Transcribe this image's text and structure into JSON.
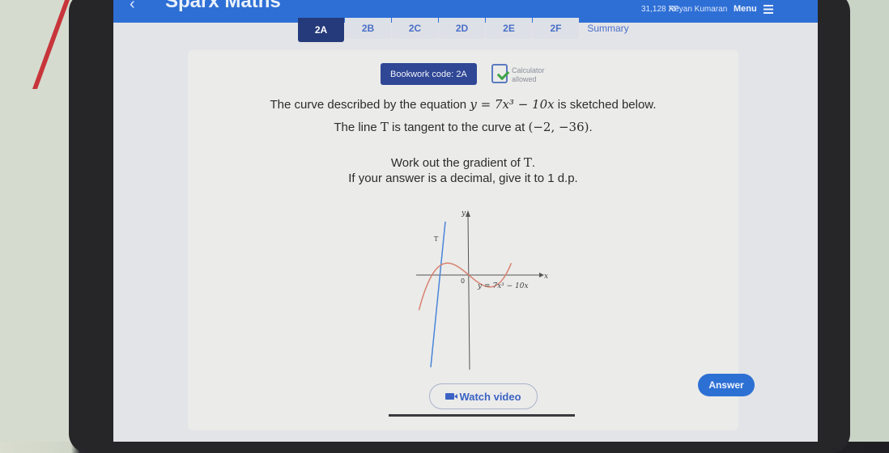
{
  "header": {
    "app_name": "Sparx Maths",
    "back_icon": "chevron-left-icon",
    "xp": "31,128 XP",
    "user_name": "Reyan Kumaran",
    "menu_label": "Menu",
    "menu_icon": "hamburger-icon"
  },
  "tabs": [
    {
      "label": "2A",
      "active": true
    },
    {
      "label": "2B",
      "active": false
    },
    {
      "label": "2C",
      "active": false
    },
    {
      "label": "2D",
      "active": false
    },
    {
      "label": "2E",
      "active": false
    },
    {
      "label": "2F",
      "active": false
    },
    {
      "label": "Summary",
      "active": false
    }
  ],
  "question": {
    "bookwork_code": "Bookwork code: 2A",
    "calculator_line1": "Calculator",
    "calculator_line2": "allowed",
    "calculator_icon": "calculator-check-icon",
    "line1_pre": "The curve described by the equation ",
    "line1_eq": "y = 7x³ − 10x",
    "line1_post": " is sketched below.",
    "line2_pre": "The line ",
    "line2_T": "T",
    "line2_mid": " is tangent to the curve at ",
    "line2_point": "(−2, −36)",
    "line2_post": ".",
    "line3_pre": "Work out the gradient of ",
    "line3_T": "T",
    "line3_post": ".",
    "line4": "If your answer is a decimal, give it to 1 d.p."
  },
  "graph": {
    "y_label": "y",
    "x_label": "x",
    "origin_label": "0",
    "tangent_label": "T",
    "curve_label": "y = 7x³ − 10x",
    "curve_color": "#d9826f",
    "tangent_color": "#4a86d8",
    "axis_color": "#555555"
  },
  "actions": {
    "watch_video": "Watch video",
    "watch_icon": "video-camera-icon",
    "answer": "Answer"
  },
  "colors": {
    "topbar": "#2e6fd6",
    "active_tab": "#253a7a",
    "bookwork": "#2f4795",
    "answer_button": "#2d70d4"
  }
}
